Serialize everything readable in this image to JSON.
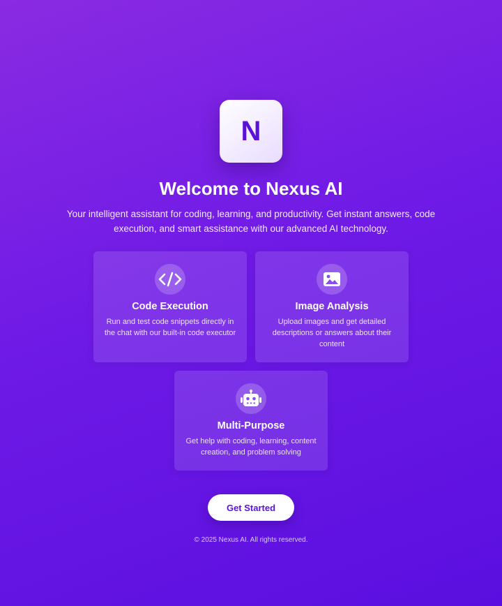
{
  "brand": {
    "logo_letter": "N",
    "accent_color": "#5b12d6"
  },
  "hero": {
    "title": "Welcome to Nexus AI",
    "subtitle": "Your intelligent assistant for coding, learning, and productivity. Get instant answers, code execution, and smart assistance with our advanced AI technology."
  },
  "features": [
    {
      "icon": "code-icon",
      "title": "Code Execution",
      "description": "Run and test code snippets directly in the chat with our built-in code executor"
    },
    {
      "icon": "image-icon",
      "title": "Image Analysis",
      "description": "Upload images and get detailed descriptions or answers about their content"
    },
    {
      "icon": "robot-icon",
      "title": "Multi-Purpose",
      "description": "Get help with coding, learning, content creation, and problem solving"
    }
  ],
  "cta": {
    "label": "Get Started"
  },
  "footer": {
    "text": "© 2025 Nexus AI. All rights reserved."
  }
}
